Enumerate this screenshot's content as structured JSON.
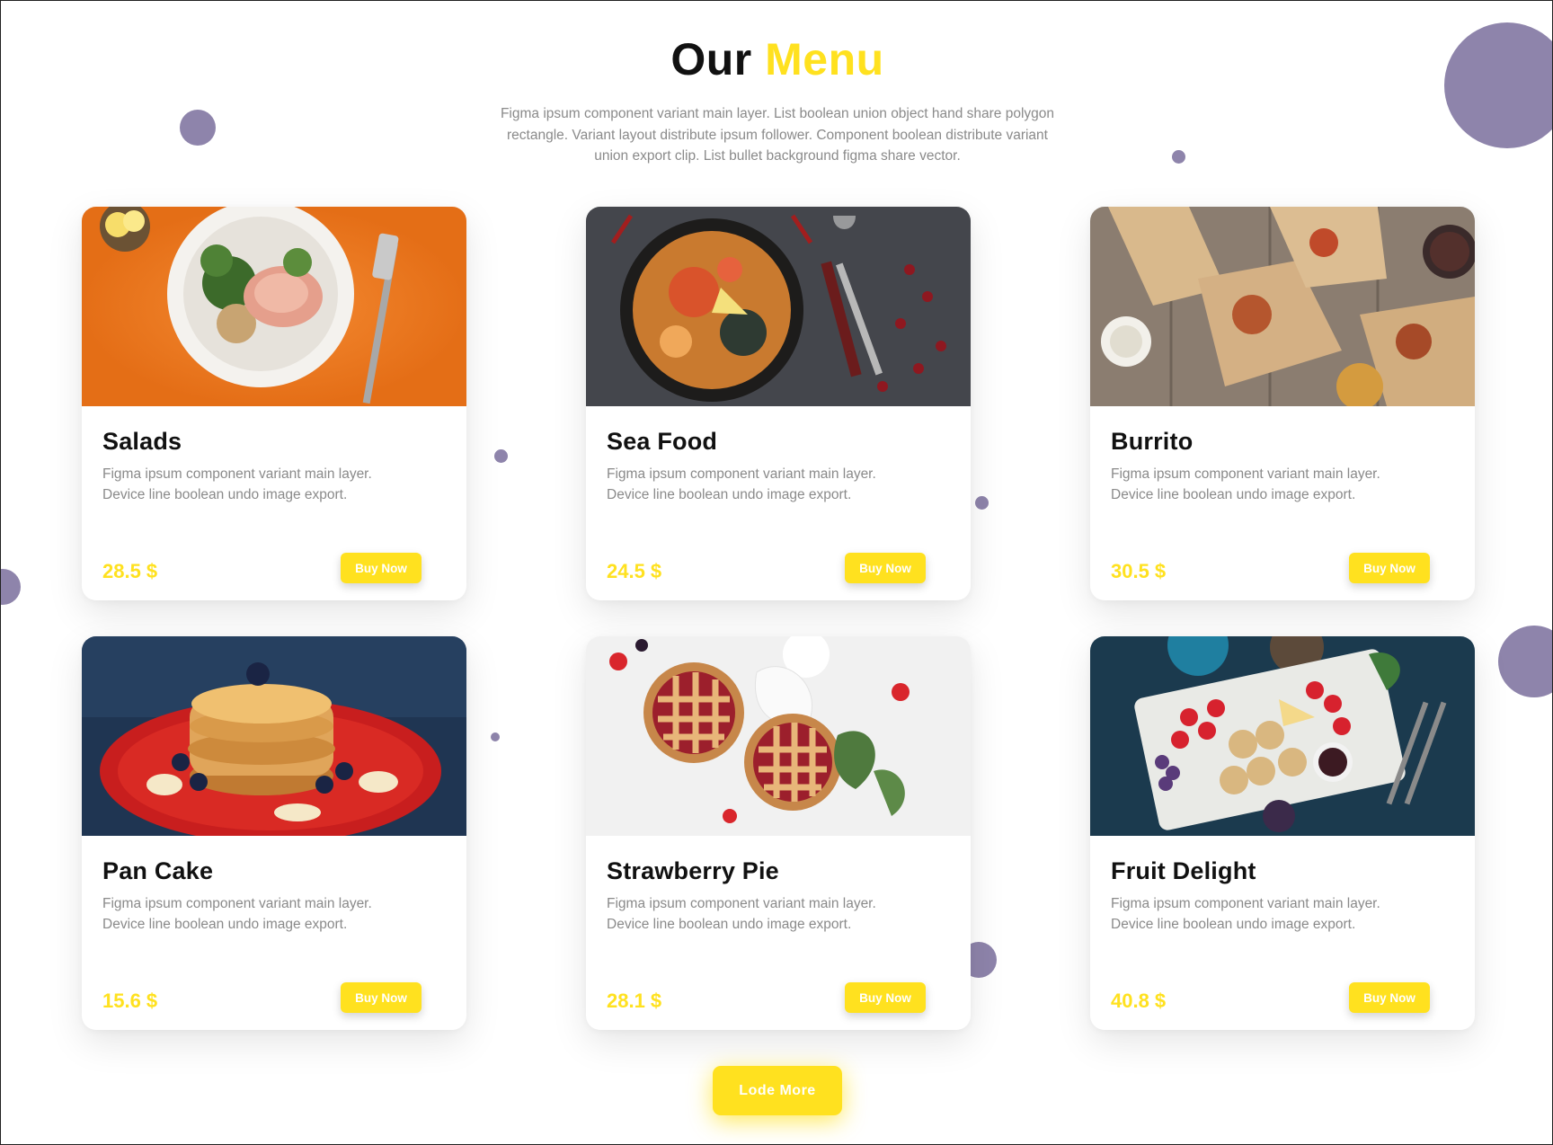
{
  "header": {
    "title_part1": "Our",
    "title_part2": "Menu",
    "subtitle": "Figma ipsum component variant main layer. List boolean union object hand share polygon rectangle. Variant layout distribute ipsum follower. Component boolean distribute variant union export clip. List bullet background figma share vector."
  },
  "colors": {
    "accent": "#ffe11f",
    "decor": "#8e84ab",
    "text": "#111111",
    "muted": "#8a8a8a"
  },
  "menu": {
    "items": [
      {
        "name": "Salads",
        "description": "Figma ipsum component variant main layer. Device line boolean undo image export.",
        "price": "28.5 $",
        "button": "Buy Now"
      },
      {
        "name": "Sea Food",
        "description": "Figma ipsum component variant main layer. Device line boolean undo image export.",
        "price": "24.5 $",
        "button": "Buy Now"
      },
      {
        "name": "Burrito",
        "description": "Figma ipsum component variant main layer. Device line boolean undo image export.",
        "price": "30.5 $",
        "button": "Buy Now"
      },
      {
        "name": "Pan Cake",
        "description": "Figma ipsum component variant main layer. Device line boolean undo image export.",
        "price": "15.6 $",
        "button": "Buy Now"
      },
      {
        "name": "Strawberry Pie",
        "description": "Figma ipsum component variant main layer. Device line boolean undo image export.",
        "price": "28.1 $",
        "button": "Buy Now"
      },
      {
        "name": "Fruit Delight",
        "description": "Figma ipsum component variant main layer. Device line boolean undo image export.",
        "price": "40.8 $",
        "button": "Buy Now"
      }
    ]
  },
  "load_more": {
    "label": "Lode More"
  }
}
